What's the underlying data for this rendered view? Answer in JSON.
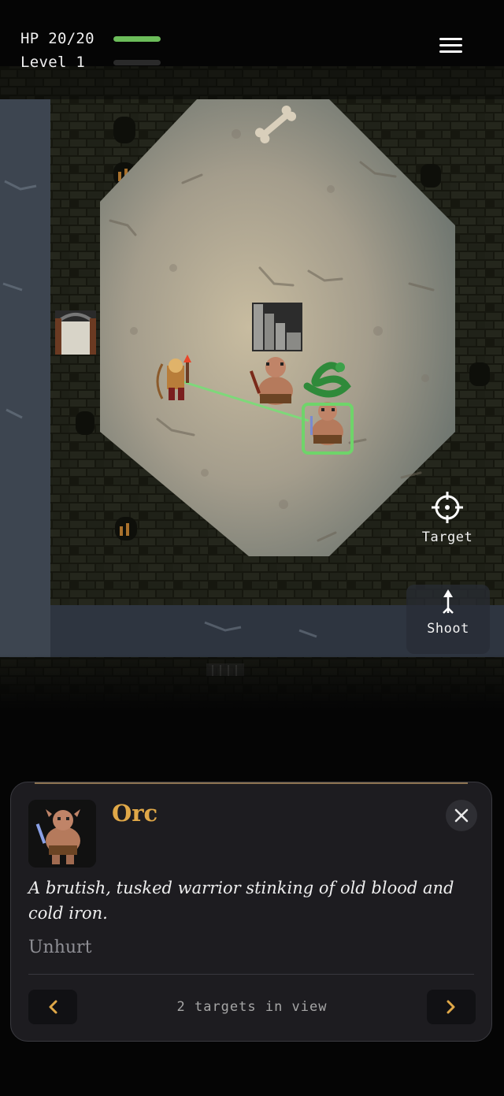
{
  "hud": {
    "hp_text": "HP 20/20",
    "hp_fraction": 1.0,
    "hp_color": "#6cbd5a",
    "level_text": "Level 1",
    "xp_fraction": 0.0,
    "menu_icon": "hamburger-menu-icon"
  },
  "actions": {
    "target_label": "Target",
    "target_icon": "crosshair-icon",
    "shoot_label": "Shoot",
    "shoot_icon": "arrow-up-icon"
  },
  "map": {
    "entities": [
      "bone",
      "stairs-down",
      "archer-hero",
      "orc",
      "green-snake",
      "orc-targeted",
      "portcullis-door"
    ],
    "target_highlight_color": "#6fd46a",
    "aim_line_color": "#7ed87a"
  },
  "target_panel": {
    "name": "Orc",
    "description": "A brutish, tusked warrior stinking of old blood and cold iron.",
    "status": "Unhurt",
    "target_count_text": "2 targets in view",
    "accent_color": "#e0a848",
    "close_icon": "close-icon",
    "prev_icon": "chevron-left-icon",
    "next_icon": "chevron-right-icon"
  }
}
